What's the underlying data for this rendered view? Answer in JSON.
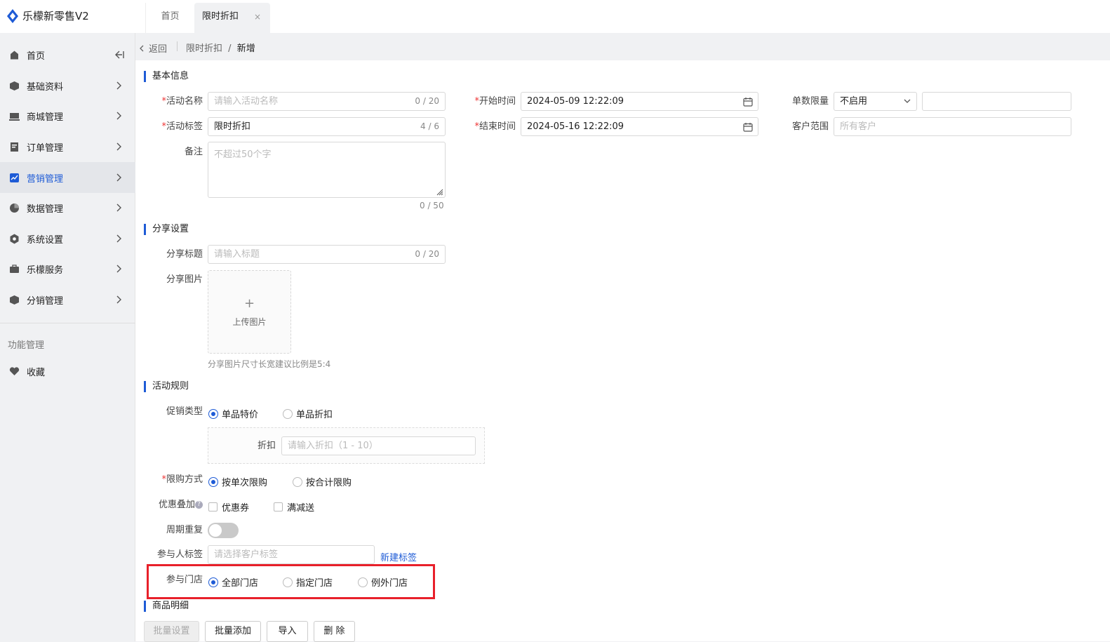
{
  "app": {
    "title": "乐檬新零售V2"
  },
  "tabs": {
    "home": "首页",
    "active": "限时折扣",
    "close": "×"
  },
  "sidebar": {
    "items": [
      {
        "label": "首页",
        "icon": "home-icon"
      },
      {
        "label": "基础资料",
        "icon": "box-icon"
      },
      {
        "label": "商城管理",
        "icon": "store-icon"
      },
      {
        "label": "订单管理",
        "icon": "order-icon"
      },
      {
        "label": "营销管理",
        "icon": "chart-icon"
      },
      {
        "label": "数据管理",
        "icon": "pie-icon"
      },
      {
        "label": "系统设置",
        "icon": "settings-icon"
      },
      {
        "label": "乐檬服务",
        "icon": "service-icon"
      },
      {
        "label": "分销管理",
        "icon": "distribution-icon"
      }
    ],
    "group_title": "功能管理",
    "favorites": "收藏"
  },
  "breadcrumb": {
    "back": "返回",
    "parent": "限时折扣",
    "separator": "/",
    "current": "新增"
  },
  "basic": {
    "title": "基本信息",
    "name_label": "活动名称",
    "name_placeholder": "请输入活动名称",
    "name_count": "0 / 20",
    "tag_label": "活动标签",
    "tag_value": "限时折扣",
    "tag_count": "4 / 6",
    "remark_label": "备注",
    "remark_placeholder": "不超过50个字",
    "remark_count": "0 / 50",
    "start_label": "开始时间",
    "start_value": "2024-05-09 12:22:09",
    "end_label": "结束时间",
    "end_value": "2024-05-16 12:22:09",
    "limit_label": "单数限量",
    "limit_value": "不启用",
    "customer_label": "客户范围",
    "customer_placeholder": "所有客户"
  },
  "share": {
    "title": "分享设置",
    "title_label": "分享标题",
    "title_placeholder": "请输入标题",
    "title_count": "0 / 20",
    "image_label": "分享图片",
    "upload_plus": "+",
    "upload_text": "上传图片",
    "image_hint": "分享图片尺寸长宽建议比例是5:4"
  },
  "rules": {
    "title": "活动规则",
    "promo_label": "促销类型",
    "promo_opt1": "单品特价",
    "promo_opt2": "单品折扣",
    "discount_label": "折扣",
    "discount_placeholder": "请输入折扣（1 - 10）",
    "purchase_label": "限购方式",
    "purchase_opt1": "按单次限购",
    "purchase_opt2": "按合计限购",
    "stack_label": "优惠叠加",
    "stack_help": "?",
    "stack_opt1": "优惠券",
    "stack_opt2": "满减送",
    "repeat_label": "周期重复",
    "member_label": "参与人标签",
    "member_placeholder": "请选择客户标签",
    "new_tag": "新建标签",
    "store_label": "参与门店",
    "store_opt1": "全部门店",
    "store_opt2": "指定门店",
    "store_opt3": "例外门店"
  },
  "goods": {
    "title": "商品明细",
    "btn_batch_set": "批量设置",
    "btn_batch_add": "批量添加",
    "btn_import": "导入",
    "btn_delete": "删 除"
  },
  "colors": {
    "accent": "#1e5bd6",
    "highlight": "#e8202a",
    "required": "#ee3333"
  }
}
